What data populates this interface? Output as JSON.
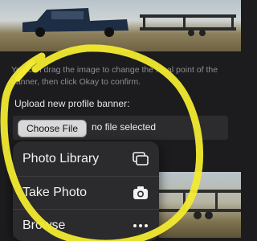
{
  "hint_text": "You can drag the image to change the focal point of the banner, then click Okay to confirm.",
  "upload": {
    "label": "Upload new profile banner:",
    "choose_button": "Choose File",
    "status": "no file selected"
  },
  "menu": {
    "items": [
      {
        "label": "Photo Library",
        "icon": "photo-library-icon"
      },
      {
        "label": "Take Photo",
        "icon": "camera-icon"
      },
      {
        "label": "Browse",
        "icon": "more-icon"
      }
    ]
  },
  "colors": {
    "annotation": "#f2ea2f",
    "menu_bg": "#2b2b2d",
    "page_bg": "#1c1c1e"
  }
}
